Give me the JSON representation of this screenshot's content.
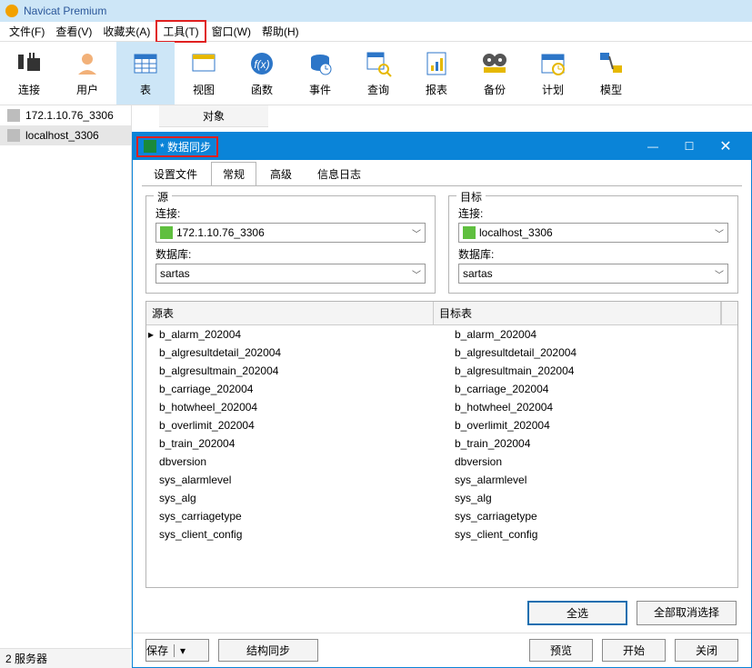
{
  "app_title": "Navicat Premium",
  "menu": {
    "file": "文件(F)",
    "view": "查看(V)",
    "fav": "收藏夹(A)",
    "tools": "工具(T)",
    "window": "窗口(W)",
    "help": "帮助(H)"
  },
  "toolbar": {
    "connect": "连接",
    "user": "用户",
    "table": "表",
    "view": "视图",
    "func": "函数",
    "event": "事件",
    "query": "查询",
    "report": "报表",
    "backup": "备份",
    "plan": "计划",
    "model": "模型"
  },
  "sidebar": {
    "object": "对象",
    "conn1": "172.1.10.76_3306",
    "conn2": "localhost_3306"
  },
  "status": "2 服务器",
  "dialog": {
    "title": "* 数据同步",
    "tabs": {
      "config": "设置文件",
      "general": "常规",
      "advanced": "高级",
      "log": "信息日志"
    },
    "src": {
      "legend": "源",
      "conn_label": "连接:",
      "conn_value": "172.1.10.76_3306",
      "db_label": "数据库:",
      "db_value": "sartas"
    },
    "dst": {
      "legend": "目标",
      "conn_label": "连接:",
      "conn_value": "localhost_3306",
      "db_label": "数据库:",
      "db_value": "sartas"
    },
    "table": {
      "h1": "源表",
      "h2": "目标表",
      "rows": [
        {
          "s": "b_alarm_202004",
          "d": "b_alarm_202004"
        },
        {
          "s": "b_algresultdetail_202004",
          "d": "b_algresultdetail_202004"
        },
        {
          "s": "b_algresultmain_202004",
          "d": "b_algresultmain_202004"
        },
        {
          "s": "b_carriage_202004",
          "d": "b_carriage_202004"
        },
        {
          "s": "b_hotwheel_202004",
          "d": "b_hotwheel_202004"
        },
        {
          "s": "b_overlimit_202004",
          "d": "b_overlimit_202004"
        },
        {
          "s": "b_train_202004",
          "d": "b_train_202004"
        },
        {
          "s": "dbversion",
          "d": "dbversion"
        },
        {
          "s": "sys_alarmlevel",
          "d": "sys_alarmlevel"
        },
        {
          "s": "sys_alg",
          "d": "sys_alg"
        },
        {
          "s": "sys_carriagetype",
          "d": "sys_carriagetype"
        },
        {
          "s": "sys_client_config",
          "d": "sys_client_config"
        }
      ]
    },
    "buttons": {
      "select_all": "全选",
      "deselect_all": "全部取消选择",
      "save": "保存",
      "struct": "结构同步",
      "preview": "预览",
      "start": "开始",
      "close": "关闭"
    }
  }
}
